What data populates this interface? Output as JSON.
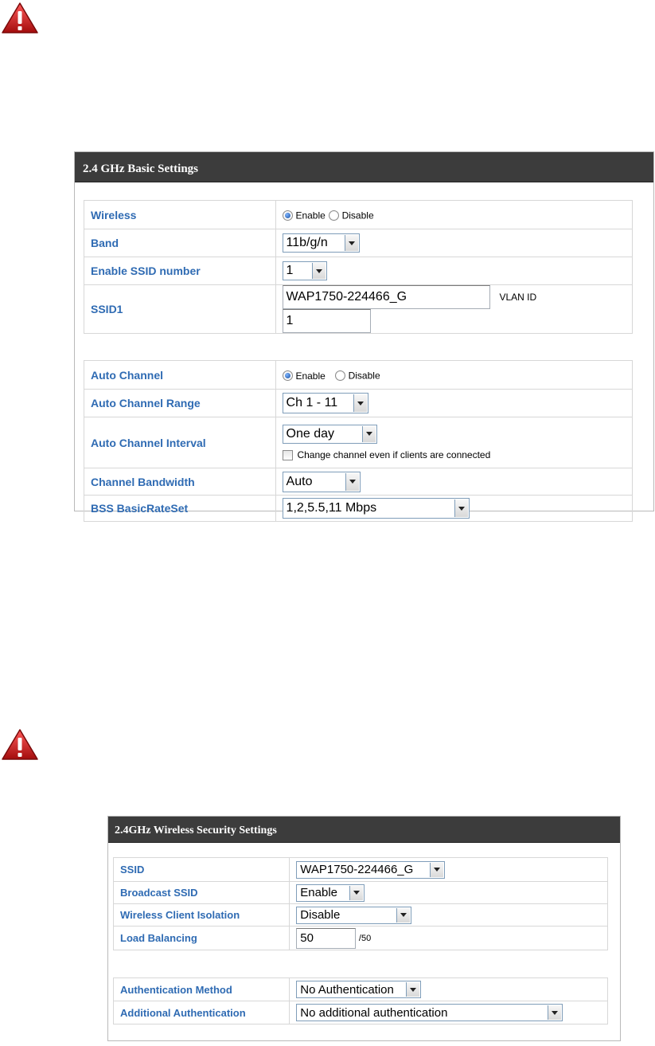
{
  "basic": {
    "title": "2.4 GHz Basic Settings",
    "wireless_label": "Wireless",
    "wireless_enable": "Enable",
    "wireless_disable": "Disable",
    "band_label": "Band",
    "band_value": "11b/g/n",
    "ssid_number_label": "Enable SSID number",
    "ssid_number_value": "1",
    "ssid1_label": "SSID1",
    "ssid1_value": "WAP1750-224466_G",
    "vlan_label": "VLAN ID",
    "vlan_value": "1",
    "auto_channel_label": "Auto Channel",
    "auto_channel_enable": "Enable",
    "auto_channel_disable": "Disable",
    "channel_range_label": "Auto Channel Range",
    "channel_range_value": "Ch 1 - 11",
    "channel_interval_label": "Auto Channel Interval",
    "channel_interval_value": "One day",
    "change_channel_label": "Change channel even if clients are connected",
    "bandwidth_label": "Channel Bandwidth",
    "bandwidth_value": "Auto",
    "rateset_label": "BSS BasicRateSet",
    "rateset_value": "1,2,5.5,11 Mbps"
  },
  "security": {
    "title": "2.4GHz Wireless Security Settings",
    "ssid_label": "SSID",
    "ssid_value": "WAP1750-224466_G",
    "broadcast_label": "Broadcast SSID",
    "broadcast_value": "Enable",
    "isolation_label": "Wireless Client Isolation",
    "isolation_value": "Disable",
    "load_label": "Load Balancing",
    "load_value": "50",
    "load_suffix": "/50",
    "auth_label": "Authentication Method",
    "auth_value": "No Authentication",
    "additional_label": "Additional Authentication",
    "additional_value": "No additional authentication"
  },
  "icons": [
    "warning-icon"
  ],
  "colors": {
    "header_bg": "#3c3c3c",
    "label_blue": "#2f6bb3",
    "warning_red": "#c8102e"
  }
}
